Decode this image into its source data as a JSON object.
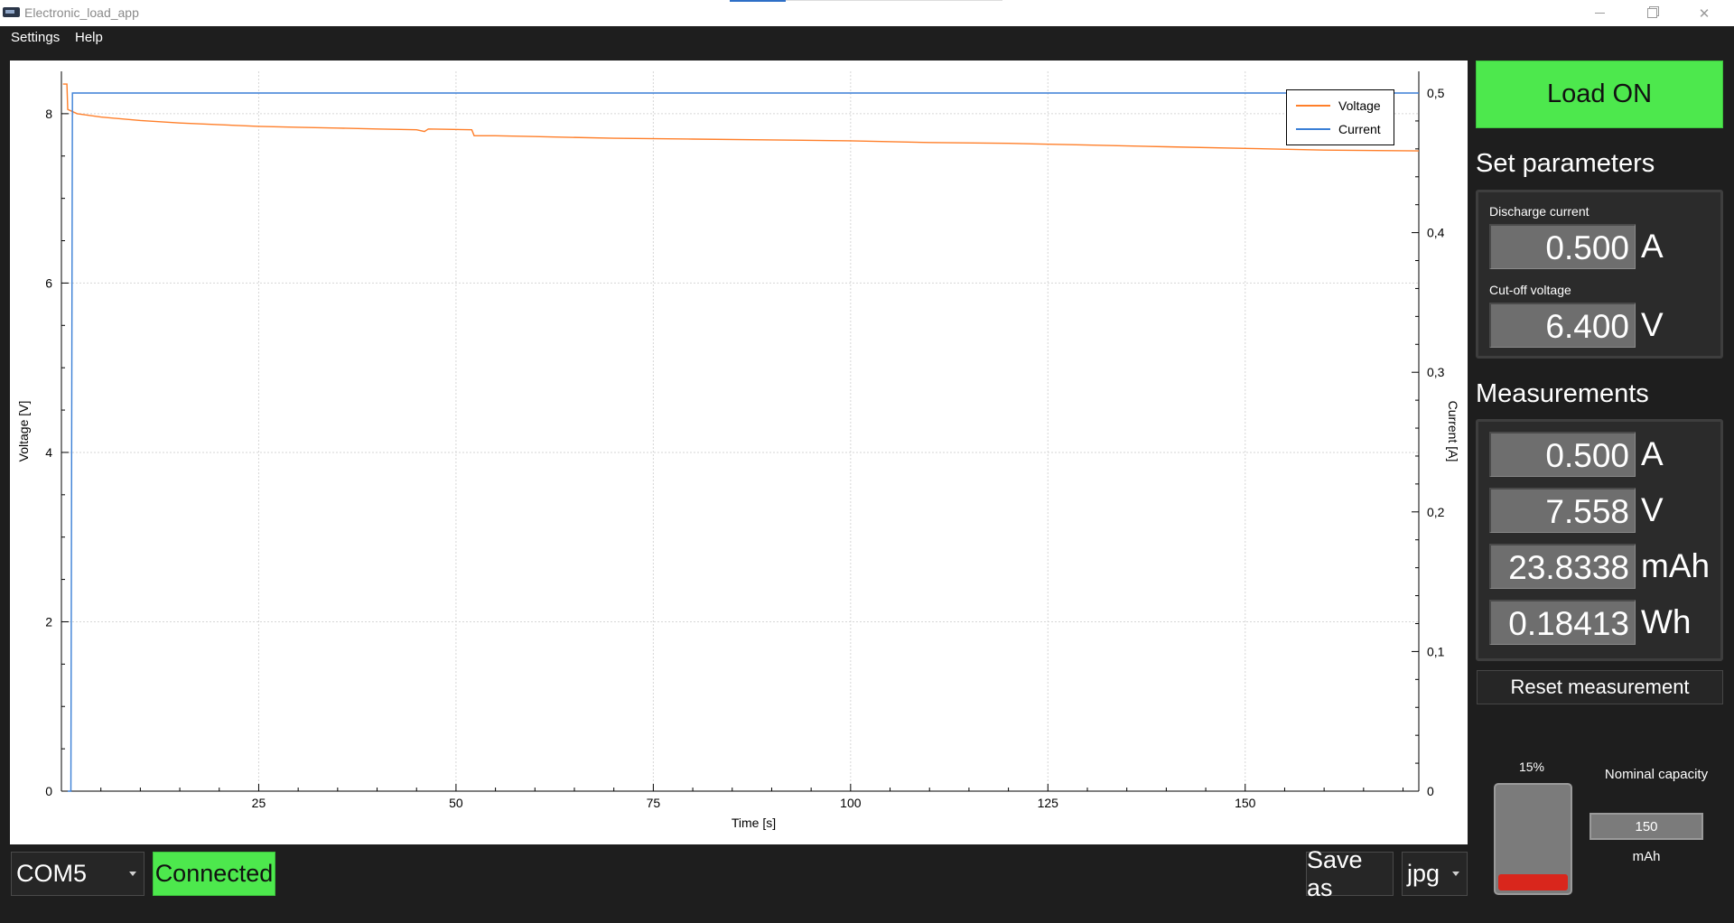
{
  "window": {
    "title": "Electronic_load_app",
    "controls": [
      "minimize",
      "maximize",
      "close"
    ]
  },
  "menu": {
    "settings": "Settings",
    "help": "Help"
  },
  "chart_data": {
    "type": "line",
    "xlabel": "Time [s]",
    "ylabel_left": "Voltage [V]",
    "ylabel_right": "Current [A]",
    "xlim": [
      0,
      172
    ],
    "ylim_left": [
      0,
      8.5
    ],
    "ylim_right": [
      0,
      0.5
    ],
    "x_ticks": [
      "25",
      "50",
      "75",
      "100",
      "125",
      "150"
    ],
    "y_left_ticks": [
      "0",
      "2",
      "4",
      "6",
      "8"
    ],
    "y_right_ticks": [
      "0",
      "0,1",
      "0,2",
      "0,3",
      "0,4",
      "0,5"
    ],
    "grid": true,
    "legend_position": "top-right",
    "series": [
      {
        "name": "Voltage",
        "axis": "left",
        "color": "#ff7f2a",
        "points": [
          [
            0.2,
            8.35
          ],
          [
            0.7,
            8.35
          ],
          [
            0.8,
            8.05
          ],
          [
            2,
            8.0
          ],
          [
            5,
            7.96
          ],
          [
            10,
            7.92
          ],
          [
            15,
            7.89
          ],
          [
            20,
            7.87
          ],
          [
            25,
            7.85
          ],
          [
            30,
            7.84
          ],
          [
            35,
            7.83
          ],
          [
            40,
            7.82
          ],
          [
            45,
            7.81
          ],
          [
            46,
            7.79
          ],
          [
            46.5,
            7.82
          ],
          [
            52,
            7.81
          ],
          [
            52.3,
            7.74
          ],
          [
            55,
            7.74
          ],
          [
            60,
            7.73
          ],
          [
            70,
            7.71
          ],
          [
            80,
            7.7
          ],
          [
            90,
            7.69
          ],
          [
            100,
            7.68
          ],
          [
            110,
            7.66
          ],
          [
            120,
            7.65
          ],
          [
            130,
            7.63
          ],
          [
            140,
            7.61
          ],
          [
            150,
            7.59
          ],
          [
            160,
            7.57
          ],
          [
            172,
            7.56
          ]
        ]
      },
      {
        "name": "Current",
        "axis": "right",
        "color": "#3a7fd6",
        "points": [
          [
            0.8,
            0.0
          ],
          [
            1.2,
            0.0
          ],
          [
            1.4,
            0.5
          ],
          [
            172,
            0.5
          ]
        ]
      }
    ]
  },
  "load_button": "Load ON",
  "set_parameters": {
    "title": "Set parameters",
    "discharge_current_label": "Discharge current",
    "discharge_current_value": "0.500",
    "discharge_current_unit": "A",
    "cutoff_voltage_label": "Cut-off voltage",
    "cutoff_voltage_value": "6.400",
    "cutoff_voltage_unit": "V"
  },
  "measurements": {
    "title": "Measurements",
    "rows": [
      {
        "value": "0.500",
        "unit": "A"
      },
      {
        "value": "7.558",
        "unit": "V"
      },
      {
        "value": "23.8338",
        "unit": "mAh"
      },
      {
        "value": "0.18413",
        "unit": "Wh"
      }
    ]
  },
  "reset_button": "Reset measurement",
  "battery": {
    "percent_label": "15%",
    "level": 0.15,
    "fill_color": "#d9261c"
  },
  "nominal_capacity": {
    "label": "Nominal capacity",
    "value": "150",
    "unit": "mAh"
  },
  "bottom_bar": {
    "port": "COM5",
    "status": "Connected",
    "save_as": "Save as",
    "format": "jpg"
  }
}
